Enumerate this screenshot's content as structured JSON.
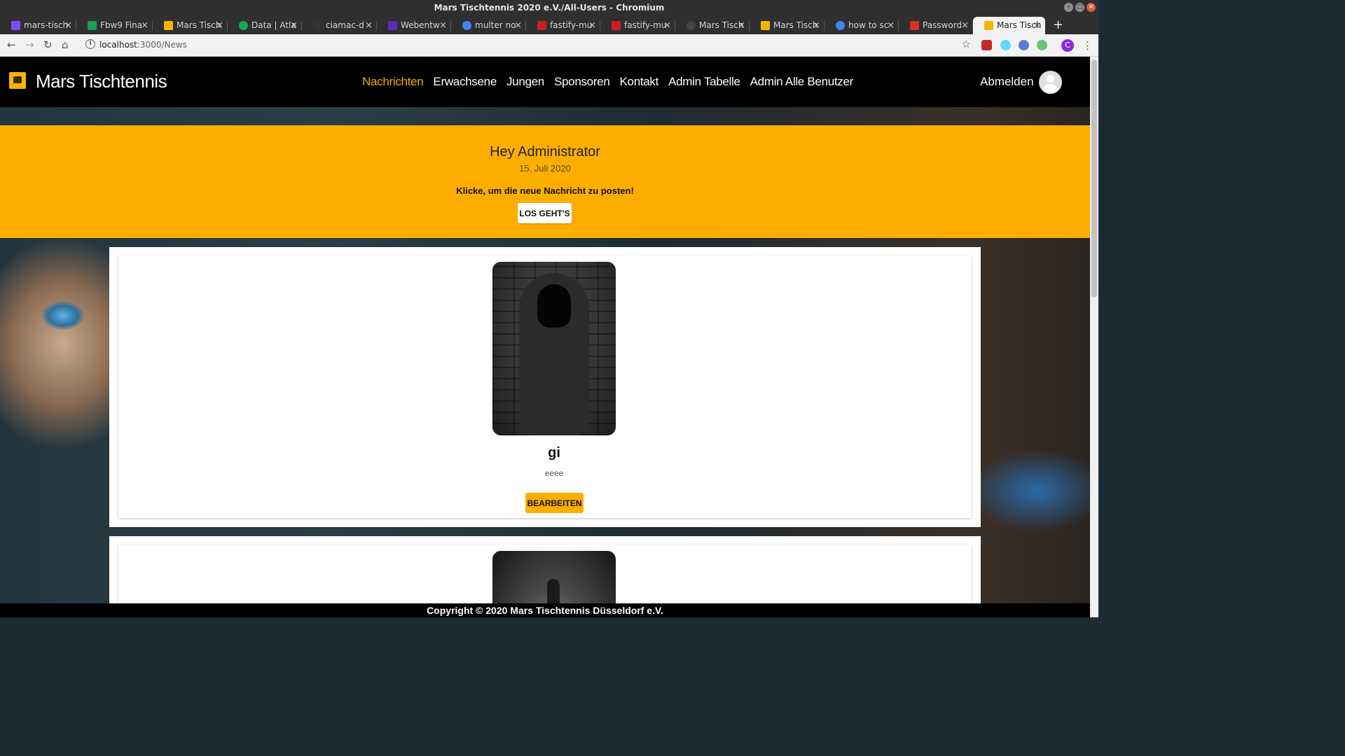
{
  "window": {
    "title": "Mars Tischtennis 2020 e.V./All-Users - Chromium"
  },
  "tabs": [
    {
      "label": "mars-tisch",
      "color": "#7b4cff"
    },
    {
      "label": "Fbw9 Fina",
      "color": "#1e9e5a"
    },
    {
      "label": "Mars Tisch",
      "color": "#f5b400"
    },
    {
      "label": "Data | Atla",
      "color": "#13aa52"
    },
    {
      "label": "ciamac-d",
      "color": "#333333"
    },
    {
      "label": "Webentw",
      "color": "#5b2bbf"
    },
    {
      "label": "multer no",
      "color": "#4285f4"
    },
    {
      "label": "fastify-mu",
      "color": "#cb1f1f"
    },
    {
      "label": "fastify-mu",
      "color": "#cb1f1f"
    },
    {
      "label": "Mars Tisch",
      "color": "#444444"
    },
    {
      "label": "Mars Tisch",
      "color": "#f5b400"
    },
    {
      "label": "how to sc",
      "color": "#4285f4"
    },
    {
      "label": "Password",
      "color": "#d93025"
    },
    {
      "label": "Mars Tisch",
      "color": "#f5b400",
      "active": true
    }
  ],
  "address": {
    "host": "localhost",
    "path": ":3000/News"
  },
  "profile_initial": "C",
  "site": {
    "brand": "Mars Tischtennis",
    "nav": [
      "Nachrichten",
      "Erwachsene",
      "Jungen",
      "Sponsoren",
      "Kontakt",
      "Admin Tabelle",
      "Admin Alle Benutzer"
    ],
    "active_nav": "Nachrichten",
    "logout": "Abmelden"
  },
  "hero": {
    "title": "Hey Administrator",
    "date": "15. Juli 2020",
    "cta": "Klicke, um die neue Nachricht zu posten!",
    "button": "LOS GEHT'S"
  },
  "posts": [
    {
      "name": "gi",
      "text": "eeee",
      "button": "BEARBEITEN"
    }
  ],
  "footer": "Copyright © 2020  Mars Tischtennis Düsseldorf e.V.",
  "colors": {
    "accent": "#feae00",
    "nav_bg": "#000000"
  }
}
